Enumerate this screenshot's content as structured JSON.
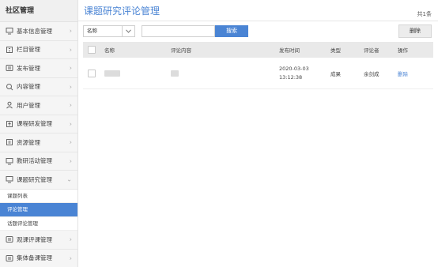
{
  "sidebar": {
    "title": "社区管理",
    "items_top": [
      {
        "label": "基本信息管理",
        "icon": "monitor-icon"
      },
      {
        "label": "栏目管理",
        "icon": "column-icon"
      },
      {
        "label": "发布管理",
        "icon": "publish-icon"
      },
      {
        "label": "内容管理",
        "icon": "search-content-icon"
      },
      {
        "label": "用户管理",
        "icon": "user-icon"
      },
      {
        "label": "课程研发管理",
        "icon": "upload-icon"
      },
      {
        "label": "资源管理",
        "icon": "resource-icon"
      },
      {
        "label": "教研活动管理",
        "icon": "monitor-icon"
      }
    ],
    "expanded_item": {
      "label": "课题研究管理",
      "icon": "monitor-icon"
    },
    "sub_items": [
      {
        "label": "课题列表",
        "active": false
      },
      {
        "label": "评论管理",
        "active": true
      },
      {
        "label": "话题评论管理",
        "active": false
      }
    ],
    "items_bottom": [
      {
        "label": "观课评课管理",
        "icon": "list-icon"
      },
      {
        "label": "集体备课管理",
        "icon": "list-icon"
      }
    ]
  },
  "header": {
    "title": "课题研究评论管理",
    "total": "共1条"
  },
  "toolbar": {
    "select_value": "名称",
    "search_placeholder": "",
    "search_label": "搜索",
    "delete_label": "删除"
  },
  "table": {
    "columns": [
      "名称",
      "评论内容",
      "发布时间",
      "类型",
      "评论者",
      "操作"
    ],
    "rows": [
      {
        "date": "2020-03-03",
        "time": "13:12:38",
        "type": "成果",
        "reviewer": "余剑成",
        "action": "删除"
      }
    ]
  },
  "colors": {
    "accent": "#4a84d4",
    "sidebar_bg": "#f5f5f5",
    "header_row_bg": "#e9e9e9"
  }
}
